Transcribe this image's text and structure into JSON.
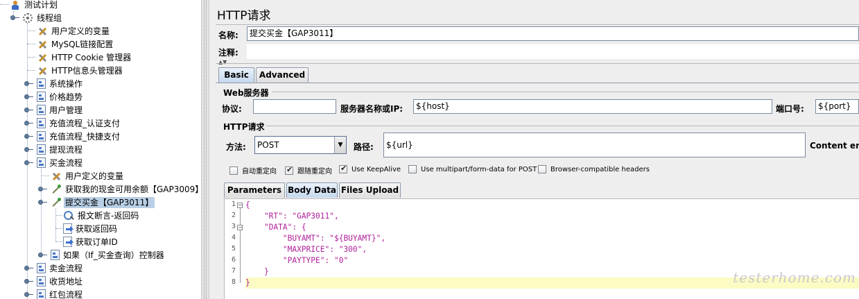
{
  "tree": {
    "items": [
      {
        "label": "测试计划",
        "icon": "test-plan-icon"
      },
      {
        "label": "线程组",
        "icon": "thread-group-icon"
      },
      {
        "label": "用户定义的变量",
        "icon": "config-element-icon"
      },
      {
        "label": "MySQL链接配置",
        "icon": "config-element-icon"
      },
      {
        "label": "HTTP Cookie 管理器",
        "icon": "config-element-icon"
      },
      {
        "label": "HTTP信息头管理器",
        "icon": "config-element-icon"
      },
      {
        "label": "系统操作",
        "icon": "controller-icon"
      },
      {
        "label": "价格趋势",
        "icon": "controller-icon"
      },
      {
        "label": "用户管理",
        "icon": "controller-icon"
      },
      {
        "label": "充值流程_认证支付",
        "icon": "controller-icon"
      },
      {
        "label": "充值流程_快捷支付",
        "icon": "controller-icon"
      },
      {
        "label": "提现流程",
        "icon": "controller-icon"
      },
      {
        "label": "买金流程",
        "icon": "controller-icon"
      },
      {
        "label": "用户定义的变量",
        "icon": "config-element-icon"
      },
      {
        "label": "获取我的现金可用余额【GAP3009】",
        "icon": "http-sampler-icon"
      },
      {
        "label": "提交买金【GAP3011】",
        "icon": "http-sampler-icon"
      },
      {
        "label": "报文断言-返回码",
        "icon": "assertion-icon"
      },
      {
        "label": "获取返回码",
        "icon": "extractor-icon"
      },
      {
        "label": "获取订单ID",
        "icon": "extractor-icon"
      },
      {
        "label": "如果（If_买金查询）控制器",
        "icon": "controller-icon"
      },
      {
        "label": "卖金流程",
        "icon": "controller-icon"
      },
      {
        "label": "收货地址",
        "icon": "controller-icon"
      },
      {
        "label": "红包流程",
        "icon": "controller-icon"
      }
    ]
  },
  "panel": {
    "title": "HTTP请求",
    "name_label": "名称:",
    "name_value": "提交买金【GAP3011】",
    "comment_label": "注释:",
    "comment_value": "",
    "tabs": [
      "Basic",
      "Advanced"
    ],
    "web_server_group": "Web服务器",
    "protocol_label": "协议:",
    "protocol_value": "",
    "server_label": "服务器名称或IP:",
    "server_value": "${host}",
    "port_label": "端口号:",
    "port_value": "${port}",
    "http_request_group": "HTTP请求",
    "method_label": "方法:",
    "method_value": "POST",
    "path_label": "路径:",
    "path_value": "${url}",
    "content_encoding_label": "Content enco",
    "checkboxes": [
      {
        "label": "自动重定向",
        "checked": false
      },
      {
        "label": "跟随重定向",
        "checked": true
      },
      {
        "label": "Use KeepAlive",
        "checked": true
      },
      {
        "label": "Use multipart/form-data for POST",
        "checked": false
      },
      {
        "label": "Browser-compatible headers",
        "checked": false
      }
    ],
    "subtabs": [
      "Parameters",
      "Body Data",
      "Files Upload"
    ]
  },
  "editor": {
    "line_numbers": [
      "1",
      "2",
      "3",
      "4",
      "5",
      "6",
      "7",
      "8"
    ],
    "lines": [
      "{",
      "    \"RT\": \"GAP3011\",",
      "    \"DATA\": {",
      "        \"BUYAMT\": \"${BUYAMT}\",",
      "        \"MAXPRICE\": \"300\",",
      "        \"PAYTYPE\": \"0\"",
      "    }",
      "}"
    ]
  },
  "watermark": "testerhome.com"
}
